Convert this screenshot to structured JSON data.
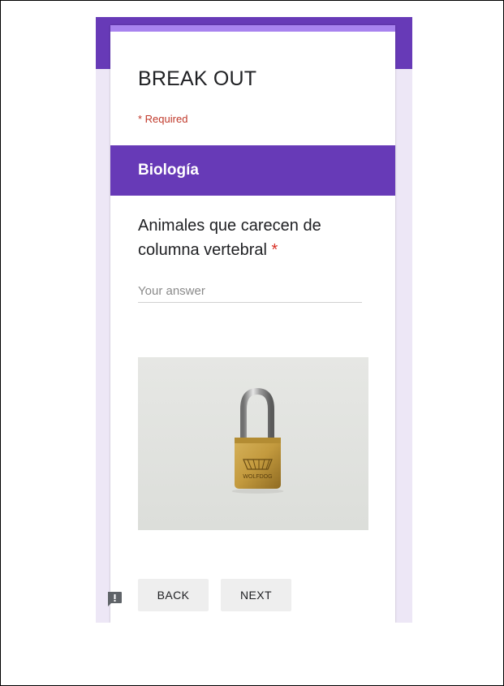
{
  "form": {
    "title": "BREAK OUT",
    "required_note": "* Required"
  },
  "section": {
    "title": "Biología"
  },
  "question": {
    "text": "Animales que carecen de columna vertebral",
    "required_marker": "*",
    "input_placeholder": "Your answer",
    "input_value": ""
  },
  "image": {
    "engraved_text": "WOLFDOG"
  },
  "navigation": {
    "back_label": "BACK",
    "next_label": "NEXT"
  },
  "icons": {
    "feedback": "report-feedback-icon"
  },
  "colors": {
    "accent": "#673ab7",
    "accent_light": "#a883ef",
    "page_background": "#ede7f6",
    "required": "#d93025"
  }
}
